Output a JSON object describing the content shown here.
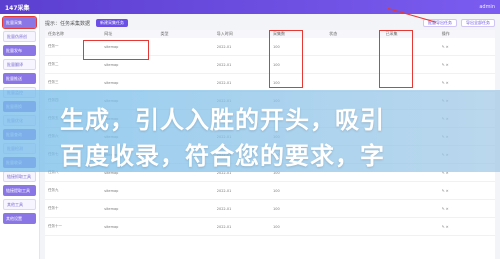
{
  "app": {
    "brand": "147采集",
    "user": "admin"
  },
  "sidebar": {
    "items": [
      {
        "label": "批量采集",
        "active": true
      },
      {
        "label": "批量伪原创"
      },
      {
        "label": "批量发布"
      },
      {
        "label": "批量翻译"
      },
      {
        "label": "批量推送"
      },
      {
        "label": "批量监控"
      },
      {
        "label": "批量替换"
      },
      {
        "label": "批量优化"
      },
      {
        "label": "批量查询"
      },
      {
        "label": "批量检测"
      },
      {
        "label": "批量收录"
      },
      {
        "label": "链接抓取工具"
      },
      {
        "label": "链接提取工具"
      },
      {
        "label": "其他工具"
      },
      {
        "label": "其他设置"
      }
    ]
  },
  "toolbar": {
    "hint": "提示：任务采集数据",
    "primary": "新建采集任务",
    "right_primary": "批量导出任务",
    "right_secondary": "导出全部任务"
  },
  "table": {
    "headers": [
      "任务名称",
      "网址",
      "类型",
      "导入时间",
      "采集数",
      "状态",
      "已采集",
      "操作"
    ],
    "rows": [
      [
        "任务一",
        "sitemap",
        "",
        "2022-01",
        "100",
        "",
        "",
        "✎ ✕"
      ],
      [
        "任务二",
        "sitemap",
        "",
        "2022-01",
        "100",
        "",
        "",
        "✎ ✕"
      ],
      [
        "任务三",
        "sitemap",
        "",
        "2022-01",
        "100",
        "",
        "",
        "✎ ✕"
      ],
      [
        "任务四",
        "sitemap",
        "",
        "2022-01",
        "100",
        "",
        "",
        "✎ ✕"
      ],
      [
        "任务五",
        "sitemap",
        "",
        "2022-01",
        "100",
        "",
        "",
        "✎ ✕"
      ],
      [
        "任务六",
        "sitemap",
        "",
        "2022-01",
        "100",
        "",
        "",
        "✎ ✕"
      ],
      [
        "任务七",
        "sitemap",
        "",
        "2022-01",
        "100",
        "",
        "",
        "✎ ✕"
      ],
      [
        "任务八",
        "sitemap",
        "",
        "2022-01",
        "100",
        "",
        "",
        "✎ ✕"
      ],
      [
        "任务九",
        "sitemap",
        "",
        "2022-01",
        "100",
        "",
        "",
        "✎ ✕"
      ],
      [
        "任务十",
        "sitemap",
        "",
        "2022-01",
        "100",
        "",
        "",
        "✎ ✕"
      ],
      [
        "任务十一",
        "sitemap",
        "",
        "2022-01",
        "100",
        "",
        "",
        "✎ ✕"
      ]
    ]
  },
  "banner": {
    "line1": "生成，引人入胜的开头，吸引",
    "line2": "百度收录，符合您的要求，字"
  }
}
